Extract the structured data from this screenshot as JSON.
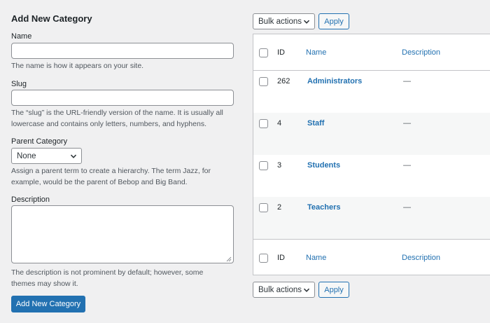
{
  "form": {
    "title": "Add New Category",
    "name_label": "Name",
    "name_value": "",
    "name_help": "The name is how it appears on your site.",
    "slug_label": "Slug",
    "slug_value": "",
    "slug_help": "The “slug” is the URL-friendly version of the name. It is usually all lowercase and contains only letters, numbers, and hyphens.",
    "parent_label": "Parent Category",
    "parent_value": "None",
    "parent_help": "Assign a parent term to create a hierarchy. The term Jazz, for example, would be the parent of Bebop and Big Band.",
    "description_label": "Description",
    "description_value": "",
    "description_help": "The description is not prominent by default; however, some themes may show it.",
    "submit_label": "Add New Category"
  },
  "bulk_top": {
    "select_value": "Bulk actions",
    "apply_label": "Apply"
  },
  "bulk_bottom": {
    "select_value": "Bulk actions",
    "apply_label": "Apply"
  },
  "table": {
    "columns": {
      "id": "ID",
      "name": "Name",
      "description": "Description"
    },
    "rows": [
      {
        "id": "262",
        "name": "Administrators",
        "description": "—"
      },
      {
        "id": "4",
        "name": "Staff",
        "description": "—"
      },
      {
        "id": "3",
        "name": "Students",
        "description": "—"
      },
      {
        "id": "2",
        "name": "Teachers",
        "description": "—"
      }
    ]
  },
  "colors": {
    "accent": "#2271b1",
    "background": "#f0f0f1",
    "text": "#1d2327"
  },
  "icons": {
    "select_arrow": "chevron-down-icon",
    "textarea_resize": "resize-grip-icon"
  }
}
